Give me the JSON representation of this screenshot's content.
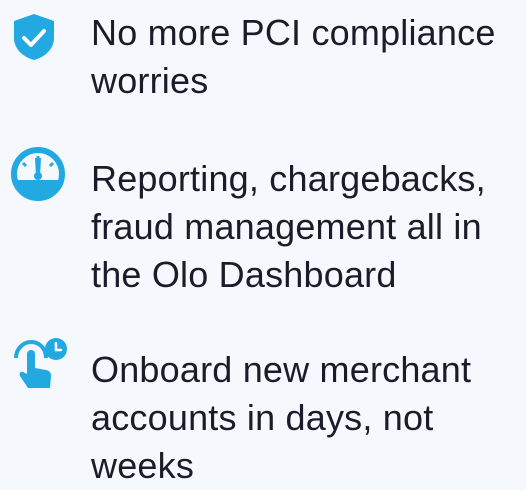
{
  "features": [
    {
      "icon": "shield-check-icon",
      "text": "No more PCI compliance worries"
    },
    {
      "icon": "speedometer-icon",
      "text": "Reporting, chargebacks, fraud management all in the Olo Dashboard"
    },
    {
      "icon": "tap-clock-icon",
      "text": "Onboard new merchant accounts in days, not weeks"
    }
  ],
  "colors": {
    "accent": "#22a9e1",
    "text": "#1b1b2a",
    "background": "#f5f8fc"
  }
}
